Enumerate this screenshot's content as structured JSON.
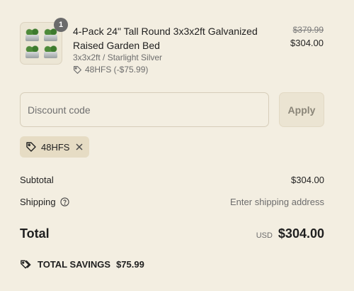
{
  "product": {
    "quantity": "1",
    "title": "4-Pack 24\" Tall Round 3x3x2ft Galvanized Raised Garden Bed",
    "variant": "3x3x2ft / Starlight Silver",
    "discount": "48HFS (-$75.99)",
    "original_price": "$379.99",
    "price": "$304.00"
  },
  "discount": {
    "placeholder": "Discount code",
    "apply_label": "Apply",
    "applied_code": "48HFS"
  },
  "totals": {
    "subtotal_label": "Subtotal",
    "subtotal_value": "$304.00",
    "shipping_label": "Shipping",
    "shipping_value": "Enter shipping address",
    "total_label": "Total",
    "currency": "USD",
    "total_value": "$304.00",
    "savings_label": "TOTAL SAVINGS",
    "savings_value": "$75.99"
  },
  "icons": {
    "tag": "tag-icon",
    "close": "close-icon",
    "help": "help-circle-icon",
    "tags": "tags-icon"
  }
}
